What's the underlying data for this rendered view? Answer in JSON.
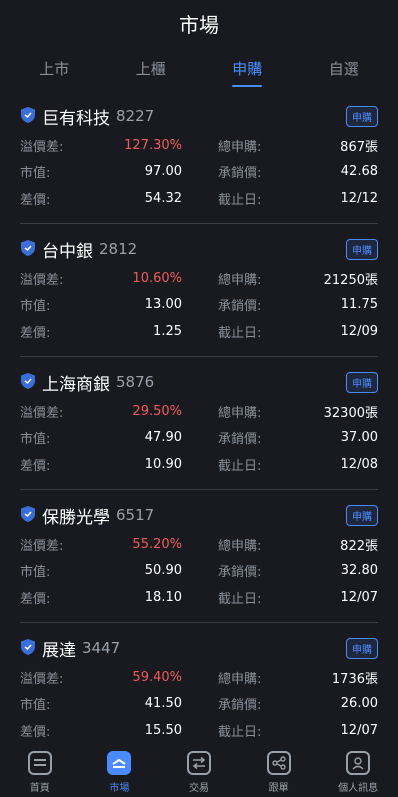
{
  "header": {
    "title": "市場"
  },
  "tabs": [
    {
      "label": "上市"
    },
    {
      "label": "上櫃"
    },
    {
      "label": "申購"
    },
    {
      "label": "自選"
    }
  ],
  "colors": {
    "accent": "#4a8cff",
    "premium": "#f05a5a"
  },
  "badge_label": "申購",
  "labels": {
    "premium": "溢價差:",
    "total": "總申購:",
    "market": "市值:",
    "underwriting": "承銷價:",
    "spread": "差價:",
    "deadline": "截止日:"
  },
  "stocks": [
    {
      "name": "巨有科技",
      "code": "8227",
      "premium": "127.30%",
      "total": "867張",
      "market": "97.00",
      "underwriting": "42.68",
      "spread": "54.32",
      "deadline": "12/12"
    },
    {
      "name": "台中銀",
      "code": "2812",
      "premium": "10.60%",
      "total": "21250張",
      "market": "13.00",
      "underwriting": "11.75",
      "spread": "1.25",
      "deadline": "12/09"
    },
    {
      "name": "上海商銀",
      "code": "5876",
      "premium": "29.50%",
      "total": "32300張",
      "market": "47.90",
      "underwriting": "37.00",
      "spread": "10.90",
      "deadline": "12/08"
    },
    {
      "name": "保勝光學",
      "code": "6517",
      "premium": "55.20%",
      "total": "822張",
      "market": "50.90",
      "underwriting": "32.80",
      "spread": "18.10",
      "deadline": "12/07"
    },
    {
      "name": "展達",
      "code": "3447",
      "premium": "59.40%",
      "total": "1736張",
      "market": "41.50",
      "underwriting": "26.00",
      "spread": "15.50",
      "deadline": "12/07"
    }
  ],
  "nav": [
    {
      "label": "首頁",
      "icon": "home-icon"
    },
    {
      "label": "市場",
      "icon": "market-icon"
    },
    {
      "label": "交易",
      "icon": "trade-icon"
    },
    {
      "label": "跟單",
      "icon": "share-icon"
    },
    {
      "label": "個人訊息",
      "icon": "profile-icon"
    }
  ]
}
